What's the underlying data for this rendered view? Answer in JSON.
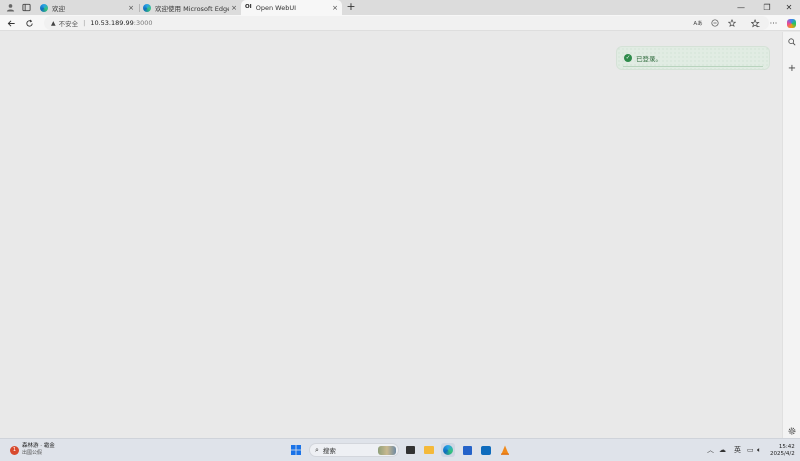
{
  "tabs": [
    {
      "label": "欢迎",
      "close": "×"
    },
    {
      "label": "欢迎使用 Microsoft Edge",
      "close": "×"
    },
    {
      "label": "Open WebUI",
      "close": "×"
    }
  ],
  "new_tab": "+",
  "window_controls": {
    "minimize": "—",
    "maximize": "❐",
    "close": "✕"
  },
  "address_bar": {
    "security_label": "不安全",
    "separator": "|",
    "host": "10.53.189.99",
    "port": ":3000"
  },
  "address_icons": {
    "read_aloud": "Aあ"
  },
  "toast": {
    "message": "已登录。"
  },
  "taskbar": {
    "weather_line1": "森林游 · 霜金",
    "weather_line2": "出國公假",
    "search_placeholder": "搜索",
    "ime": "英",
    "time": "15:42",
    "date": "2025/4/2"
  },
  "colors": {
    "edge_blue": "#0f6cbd",
    "toast_bg": "#e1ece3",
    "toast_check": "#2e8b4a",
    "toast_text": "#2f6a3c"
  }
}
